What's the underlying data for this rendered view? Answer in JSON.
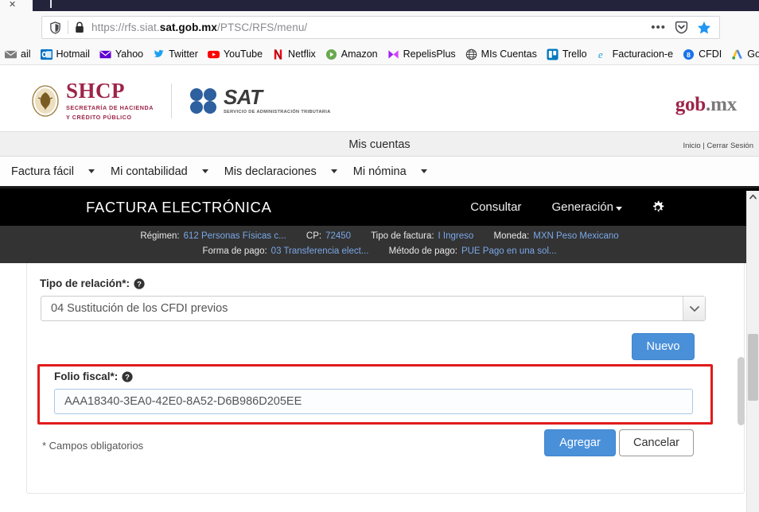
{
  "browser": {
    "tab_close_label": "✕",
    "url_display_prefix": "https://rfs.siat.",
    "url_display_bold": "sat.gob.mx",
    "url_display_suffix": "/PTSC/RFS/menu/",
    "url_full": "https://rfs.siat.sat.gob.mx/PTSC/RFS/menu/",
    "bookmarks": [
      {
        "label": "ail",
        "icon": "mail-icon",
        "color": "#7b7b7b"
      },
      {
        "label": "Hotmail",
        "icon": "outlook-icon",
        "color": "#0072c6"
      },
      {
        "label": "Yahoo",
        "icon": "yahoo-mail-icon",
        "color": "#6001d2"
      },
      {
        "label": "Twitter",
        "icon": "twitter-bird-icon",
        "color": "#1da1f2"
      },
      {
        "label": "YouTube",
        "icon": "youtube-icon",
        "color": "#ff0000"
      },
      {
        "label": "Netflix",
        "icon": "netflix-icon",
        "color": "#e50914"
      },
      {
        "label": "Amazon",
        "icon": "amazon-play-icon",
        "color": "#6aa84f"
      },
      {
        "label": "RepelisPlus",
        "icon": "repelisplus-icon",
        "color": "#a020f0"
      },
      {
        "label": "MIs Cuentas",
        "icon": "globe-icon",
        "color": "#4a4a4a"
      },
      {
        "label": "Trello",
        "icon": "trello-icon",
        "color": "#0079bf"
      },
      {
        "label": "Facturacion-e",
        "icon": "edge-e-icon",
        "color": "#1e9bd7"
      },
      {
        "label": "CFDI",
        "icon": "cfdi-badge-icon",
        "color": "#1a73e8"
      },
      {
        "label": "Google Ads",
        "icon": "google-ads-icon",
        "color": "#4285f4"
      }
    ]
  },
  "gov_header": {
    "shcp_title": "SHCP",
    "shcp_sub_line1": "SECRETARÍA DE HACIENDA",
    "shcp_sub_line2": "Y CRÉDITO PÚBLICO",
    "sat_title": "SAT",
    "sat_sub": "SERVICIO DE ADMINISTRACIÓN TRIBUTARIA",
    "gobmx_main": "gob",
    "gobmx_suffix": ".mx"
  },
  "account_bar": {
    "title": "Mis cuentas",
    "home_link": "Inicio",
    "separator": "|",
    "logout_link": "Cerrar Sesión"
  },
  "mainnav": {
    "items": [
      {
        "label": "Factura fácil"
      },
      {
        "label": "Mi contabilidad"
      },
      {
        "label": "Mis declaraciones"
      },
      {
        "label": "Mi nómina"
      }
    ]
  },
  "appbar": {
    "brand": "FACTURA ELECTRÓNICA",
    "link_consultar": "Consultar",
    "link_generacion": "Generación",
    "gear_icon": "gear-icon"
  },
  "infostrip": {
    "line1": [
      {
        "label": "Régimen:",
        "value": "612 Personas Físicas c..."
      },
      {
        "label": "CP:",
        "value": "72450"
      },
      {
        "label": "Tipo de factura:",
        "value": "I Ingreso"
      },
      {
        "label": "Moneda:",
        "value": "MXN Peso Mexicano"
      }
    ],
    "line2": [
      {
        "label": "Forma de pago:",
        "value": "03 Transferencia elect..."
      },
      {
        "label": "Método de pago:",
        "value": "PUE Pago en una sol..."
      }
    ]
  },
  "form": {
    "tipo_relacion_label": "Tipo de relación*:",
    "tipo_relacion_value": "04 Sustitución de los CFDI previos",
    "nuevo_button": "Nuevo",
    "folio_fiscal_label": "Folio fiscal*:",
    "folio_fiscal_value": "AAA18340-3EA0-42E0-8A52-D6B986D205EE",
    "required_note": "* Campos obligatorios",
    "agregar_button": "Agregar",
    "cancelar_button": "Cancelar",
    "help_icon": "help-question-icon",
    "accent_primary": "#4a90d9",
    "highlight_border": "#e01b1b"
  }
}
